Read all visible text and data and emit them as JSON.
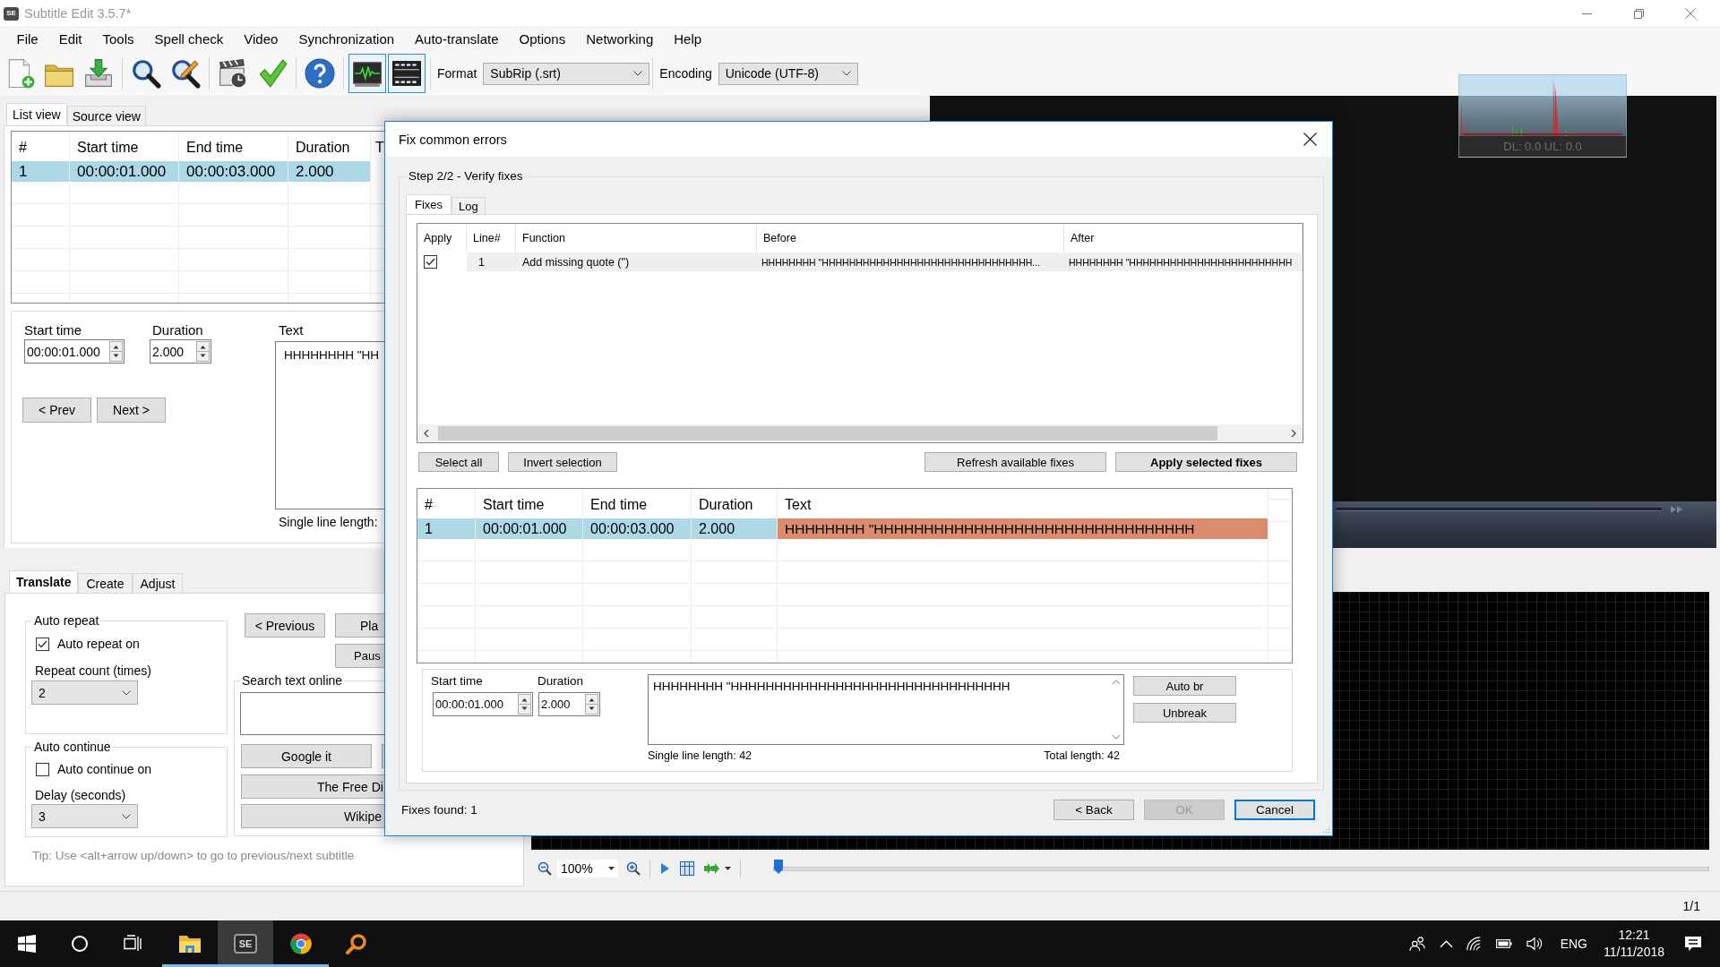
{
  "window": {
    "logo": "SE",
    "title": "Subtitle Edit 3.5.7*"
  },
  "menu": [
    "File",
    "Edit",
    "Tools",
    "Spell check",
    "Video",
    "Synchronization",
    "Auto-translate",
    "Options",
    "Networking",
    "Help"
  ],
  "toolbar": {
    "groups": [
      [
        {
          "kind": "new",
          "selected": false
        },
        {
          "kind": "open",
          "selected": false
        },
        {
          "kind": "save",
          "selected": false
        }
      ],
      [
        {
          "kind": "find",
          "selected": false
        },
        {
          "kind": "replace",
          "selected": false
        }
      ],
      [
        {
          "kind": "sync",
          "selected": false
        },
        {
          "kind": "spellcheck",
          "selected": false
        }
      ],
      [
        {
          "kind": "help",
          "selected": false
        }
      ],
      [
        {
          "kind": "waveform",
          "selected": true
        },
        {
          "kind": "video",
          "selected": true
        }
      ]
    ],
    "format": {
      "label": "Format",
      "value": "SubRip (.srt)"
    },
    "encoding": {
      "label": "Encoding",
      "value": "Unicode (UTF-8)"
    }
  },
  "view_tabs": [
    {
      "label": "List view",
      "selected": true
    },
    {
      "label": "Source view",
      "selected": false
    }
  ],
  "subtitle_list": {
    "columns": [
      "#",
      "Start time",
      "End time",
      "Duration",
      "T"
    ],
    "rows": [
      {
        "selected": true,
        "cells": [
          "1",
          "00:00:01.000",
          "00:00:03.000",
          "2.000"
        ]
      }
    ]
  },
  "editor": {
    "start_time": {
      "label": "Start time",
      "value": "00:00:01.000"
    },
    "duration": {
      "label": "Duration",
      "value": "2.000"
    },
    "text": {
      "label": "Text",
      "value": "HHHHHHHH \"HH"
    },
    "buttons": [
      "< Prev",
      "Next >"
    ],
    "single_line_length": "Single line length:"
  },
  "bottom_tabs": [
    {
      "label": "Translate",
      "selected": true
    },
    {
      "label": "Create",
      "selected": false
    },
    {
      "label": "Adjust",
      "selected": false
    }
  ],
  "translate": {
    "auto_repeat": {
      "title": "Auto repeat",
      "checkbox": {
        "label": "Auto repeat on",
        "checked": true
      },
      "count_label": "Repeat count (times)",
      "count": "2"
    },
    "auto_continue": {
      "title": "Auto continue",
      "checkbox": {
        "label": "Auto continue on",
        "checked": false
      },
      "delay_label": "Delay (seconds)",
      "delay": "3"
    },
    "playback_buttons": [
      "< Previous",
      "Pla",
      "Paus"
    ],
    "search_online": {
      "title": "Search text online",
      "buttons": [
        "Google it",
        "The Free Di",
        "Wikipe"
      ]
    },
    "tip": "Tip: Use <alt+arrow up/down> to go to previous/next subtitle"
  },
  "network_meter": {
    "text": "DL: 0.0 UL: 0.0"
  },
  "waveform": {
    "zoom": "100%",
    "position": {
      "level": 0
    }
  },
  "status_bar": {
    "counter": "1/1"
  },
  "dialog": {
    "title": "Fix common errors",
    "step": "Step 2/2 - Verify fixes",
    "tabs": [
      {
        "label": "Fixes",
        "selected": true
      },
      {
        "label": "Log",
        "selected": false
      }
    ],
    "fixes": {
      "columns": [
        "Apply",
        "Line#",
        "Function",
        "Before",
        "After"
      ],
      "rows": [
        {
          "selected": true,
          "apply": true,
          "line": "1",
          "function": "Add missing quote (\")",
          "before": "HHHHHHHH \"HHHHHHHHHHHHHHHHHHHHHHHHHHHHHHH...",
          "after": "HHHHHHHH \"HHHHHHHHHHHHHHHHHHHHHHHH"
        }
      ]
    },
    "fix_buttons": {
      "left": [
        {
          "label": "Select all",
          "primary": false
        },
        {
          "label": "Invert selection",
          "primary": false
        }
      ],
      "right": [
        {
          "label": "Refresh available fixes",
          "primary": false
        },
        {
          "label": "Apply selected fixes",
          "primary": true
        }
      ]
    },
    "subtitles": {
      "columns": [
        "#",
        "Start time",
        "End time",
        "Duration",
        "Text"
      ],
      "rows": [
        {
          "selected": true,
          "marked": true,
          "cells": [
            "1",
            "00:00:01.000",
            "00:00:03.000",
            "2.000",
            "HHHHHHHH \"HHHHHHHHHHHHHHHHHHHHHHHHHHHHHHHH"
          ]
        }
      ]
    },
    "editor": {
      "start_time": {
        "label": "Start time",
        "value": "00:00:01.000"
      },
      "duration": {
        "label": "Duration",
        "value": "2.000"
      },
      "text": "HHHHHHHH \"HHHHHHHHHHHHHHHHHHHHHHHHHHHHHHHH",
      "buttons": [
        "Auto br",
        "Unbreak"
      ],
      "single_line_length": "Single line length: 42",
      "total_length": "Total length: 42"
    },
    "fixes_found": "Fixes found: 1",
    "buttons": [
      {
        "label": "< Back",
        "disabled": false,
        "focused": false
      },
      {
        "label": "OK",
        "disabled": true,
        "focused": false
      },
      {
        "label": "Cancel",
        "disabled": false,
        "focused": true
      }
    ]
  },
  "taskbar": {
    "apps": [
      {
        "kind": "explorer",
        "running": true,
        "active": false
      },
      {
        "kind": "subtitle-edit",
        "label": "SE",
        "running": true,
        "active": true
      },
      {
        "kind": "chrome",
        "running": true,
        "active": false
      },
      {
        "kind": "magnifier",
        "running": false,
        "active": false
      }
    ],
    "language": "ENG",
    "time": "12:21",
    "date": "11/11/2018"
  }
}
